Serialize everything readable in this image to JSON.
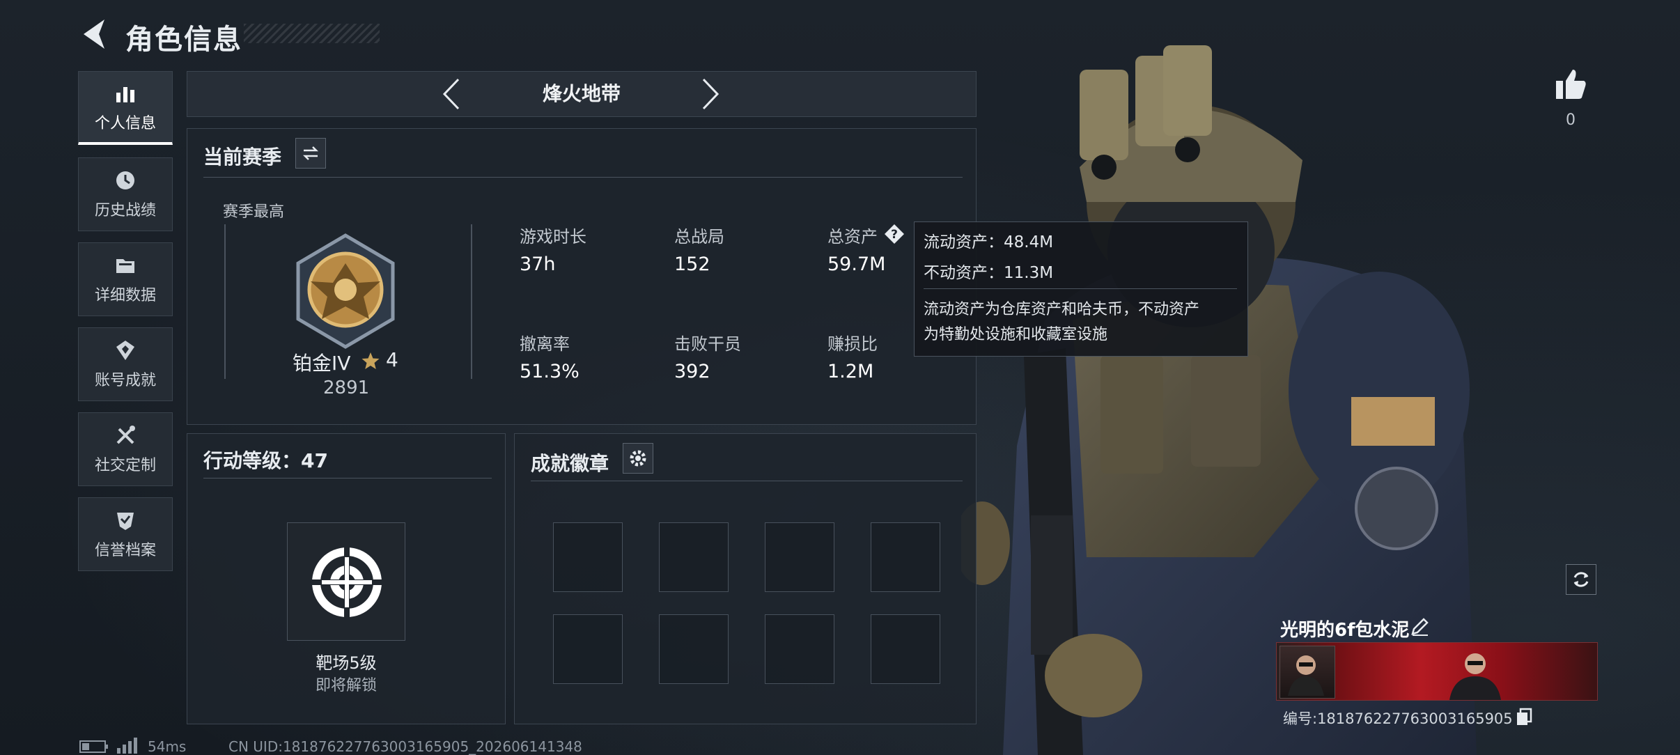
{
  "header": {
    "title": "角色信息"
  },
  "sidebar": {
    "items": [
      {
        "label": "个人信息",
        "icon": "bar-chart-icon",
        "active": true
      },
      {
        "label": "历史战绩",
        "icon": "history-clock-icon"
      },
      {
        "label": "详细数据",
        "icon": "folder-icon"
      },
      {
        "label": "账号成就",
        "icon": "achievement-badge-icon"
      },
      {
        "label": "社交定制",
        "icon": "tools-icon"
      },
      {
        "label": "信誉档案",
        "icon": "shield-check-icon"
      }
    ]
  },
  "mode_selector": {
    "label": "烽火地带"
  },
  "season": {
    "title": "当前赛季",
    "best_label": "赛季最高",
    "rank_name": "铂金IV",
    "rank_stars": "4",
    "rank_score": "2891",
    "stats": [
      {
        "label": "游戏时长",
        "value": "37h"
      },
      {
        "label": "总战局",
        "value": "152"
      },
      {
        "label": "总资产",
        "value": "59.7M"
      },
      {
        "label": "撤离率",
        "value": "51.3%"
      },
      {
        "label": "击败干员",
        "value": "392"
      },
      {
        "label": "赚损比",
        "value": "1.2M"
      }
    ]
  },
  "tooltip": {
    "liquid": "流动资产：48.4M",
    "fixed": "不动资产：11.3M",
    "desc_line1": "流动资产为仓库资产和哈夫币，不动资产",
    "desc_line2": "为特勤处设施和收藏室设施"
  },
  "action_level": {
    "title": "行动等级：47",
    "item_name": "靶场5级",
    "item_status": "即将解锁"
  },
  "badges": {
    "title": "成就徽章",
    "slots": 8
  },
  "likes": {
    "count": "0"
  },
  "player": {
    "name": "光明的6f包水泥",
    "id_text": "编号:181876227763003165905"
  },
  "footer": {
    "ping": "54ms",
    "uid": "CN UID:181876227763003165905_202606141348"
  },
  "colors": {
    "accent": "#ffffff",
    "panel": "#1e242c",
    "gold": "#c9a45c",
    "tag_red": "#a3141c"
  }
}
